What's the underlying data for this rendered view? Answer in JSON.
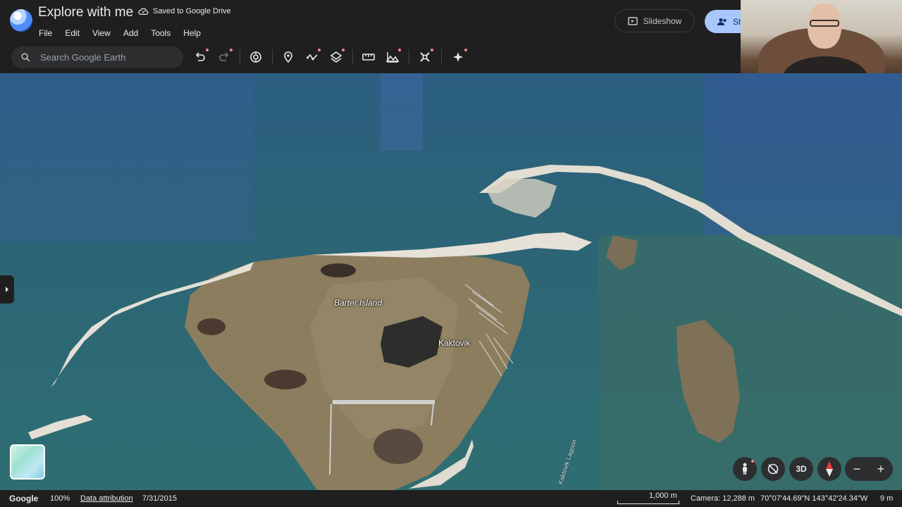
{
  "header": {
    "title": "Explore with me",
    "saved_status": "Saved to Google Drive",
    "slideshow_label": "Slideshow",
    "share_label": "Sh"
  },
  "menu": [
    "File",
    "Edit",
    "View",
    "Add",
    "Tools",
    "Help"
  ],
  "search": {
    "placeholder": "Search Google Earth"
  },
  "toolbar_icons": [
    "undo-icon",
    "redo-icon",
    "voyager-icon",
    "placemark-icon",
    "path-icon",
    "layers-icon",
    "ruler-icon",
    "elevation-icon",
    "satellite-icon",
    "sparkle-icon"
  ],
  "map": {
    "labels": {
      "barter_island": "Barter Island",
      "kaktovik": "Kaktovik",
      "lagoon": "Kaktovik Lagoon"
    }
  },
  "controls": {
    "three_d_label": "3D",
    "zoom_out": "−",
    "zoom_in": "+"
  },
  "status": {
    "brand": "Google",
    "zoom": "100%",
    "attribution": "Data attribution",
    "date": "7/31/2015",
    "scale": "1,000 m",
    "camera": "Camera: 12,288 m",
    "coordinates": "70°07'44.69\"N 143°42'24.34\"W",
    "elevation": "9 m"
  },
  "colors": {
    "accent": "#a8c7fa",
    "header_bg": "#1f1f1f",
    "water": "#2a6274",
    "land": "#8c8060",
    "sand": "#e6e1d6"
  }
}
